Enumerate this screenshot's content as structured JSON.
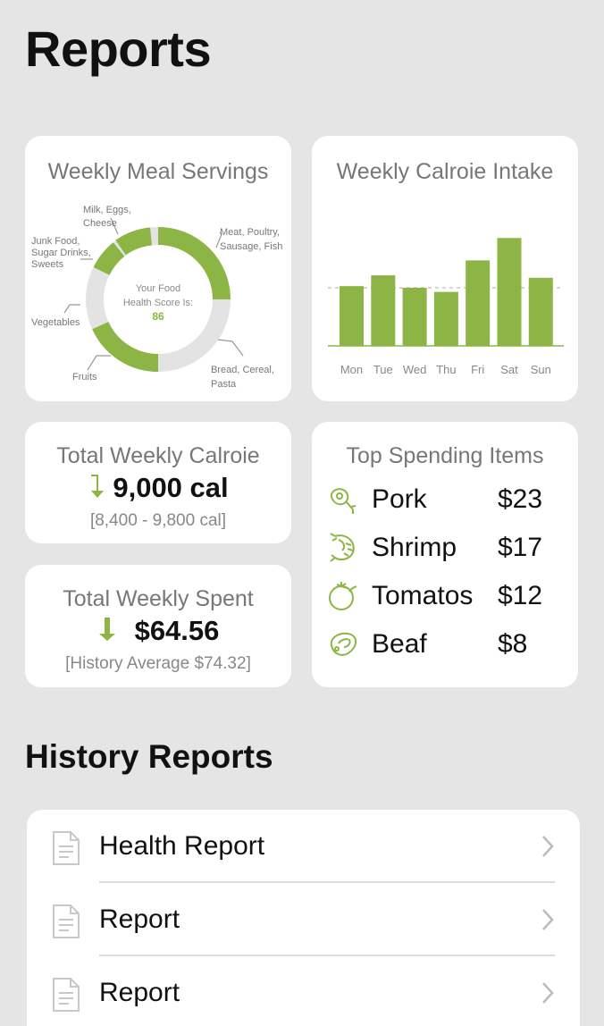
{
  "page": {
    "title": "Reports"
  },
  "colors": {
    "accent": "#8db545",
    "ring_gray": "#e3e3e3",
    "text_muted": "#777777"
  },
  "meal_servings": {
    "title": "Weekly Meal Servings",
    "center_line1": "Your Food",
    "center_line2": "Health Score Is:",
    "score": "86",
    "labels": {
      "milk_l1": "Milk, Eggs,",
      "milk_l2": "Cheese",
      "junk_l1": "Junk Food,",
      "junk_l2": "Sugar Drinks,",
      "junk_l3": "Sweets",
      "meat_l1": "Meat, Poultry,",
      "meat_l2": "Sausage, Fish",
      "veg": "Vegetables",
      "fruits": "Fruits",
      "bread_l1": "Bread, Cereal,",
      "bread_l2": "Pasta"
    }
  },
  "chart_data": {
    "type": "bar",
    "title": "Weekly Calroie Intake",
    "categories": [
      "Mon",
      "Tue",
      "Wed",
      "Thu",
      "Fri",
      "Sat",
      "Sun"
    ],
    "values": [
      72,
      85,
      70,
      65,
      103,
      130,
      82
    ],
    "average_line": 70,
    "ylim": [
      0,
      140
    ],
    "grid": false
  },
  "total_calorie": {
    "title": "Total Weekly Calroie",
    "value": "9,000 cal",
    "range": "[8,400 - 9,800 cal]"
  },
  "total_spent": {
    "title": "Total Weekly Spent",
    "value": "$64.56",
    "range": "[History Average $74.32]"
  },
  "top_spending": {
    "title": "Top Spending Items",
    "items": [
      {
        "icon": "pork-icon",
        "name": "Pork",
        "price": "$23"
      },
      {
        "icon": "shrimp-icon",
        "name": "Shrimp",
        "price": "$17"
      },
      {
        "icon": "tomato-icon",
        "name": "Tomatos",
        "price": "$12"
      },
      {
        "icon": "beef-icon",
        "name": "Beaf",
        "price": "$8"
      }
    ]
  },
  "history": {
    "title": "History Reports",
    "items": [
      {
        "label": "Health Report"
      },
      {
        "label": "Report"
      },
      {
        "label": "Report"
      }
    ]
  }
}
